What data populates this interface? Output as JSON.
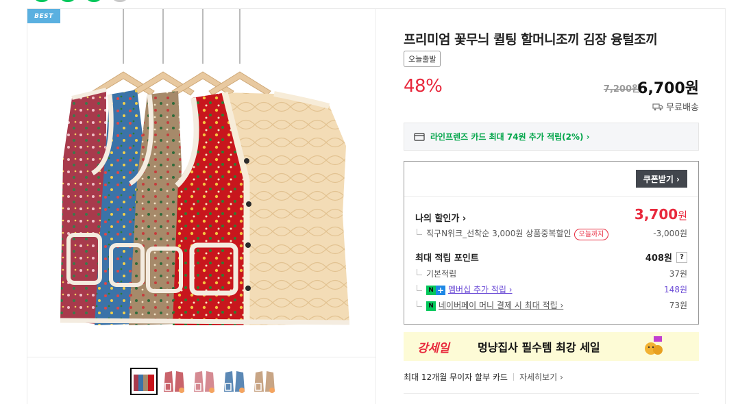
{
  "badge": "BEST",
  "product": {
    "title": "프리미엄 꽃무늬 퀼팅 할머니조끼 김장 융털조끼",
    "tag": "오늘출발",
    "discount_rate": "48%",
    "original_price": "7,200원",
    "sale_price": "6,700원",
    "shipping": "무료배송"
  },
  "card_promo": "라인프렌즈 카드 최대 74원 추가 적립(2%) ›",
  "coupon": {
    "button": "쿠폰받기 ›",
    "my_discount_label": "나의 할인가 ›",
    "my_discount_value": "3,700",
    "my_discount_unit": "원",
    "sub_discount_label": "직구N위크_선착순 3,000원 상품중복할인",
    "sub_discount_pill": "오늘까지",
    "sub_discount_value": "-3,000원",
    "points_label": "최대 적립 포인트",
    "points_value": "408원",
    "points_help": "?",
    "basic_label": "기본적립",
    "basic_value": "37원",
    "membership_label": "멤버십 추가 적립 ›",
    "membership_value": "148원",
    "npay_label": "네이버페이 머니 결제 시 최대 적립 ›",
    "npay_value": "73원"
  },
  "banner": {
    "brand": "강세일",
    "text": "멍냥집사 필수템 최강 세일"
  },
  "installment": {
    "text": "최대 12개월 무이자 할부 카드",
    "more": "자세히보기 ›"
  },
  "thumbnails": [
    "#c0282e",
    "#c9636b",
    "#d58a92",
    "#5b88b5",
    "#c8a585"
  ],
  "colors": {
    "accent_red": "#e8283c",
    "naver_green": "#03c75a",
    "best_blue": "#5ab0e0"
  }
}
